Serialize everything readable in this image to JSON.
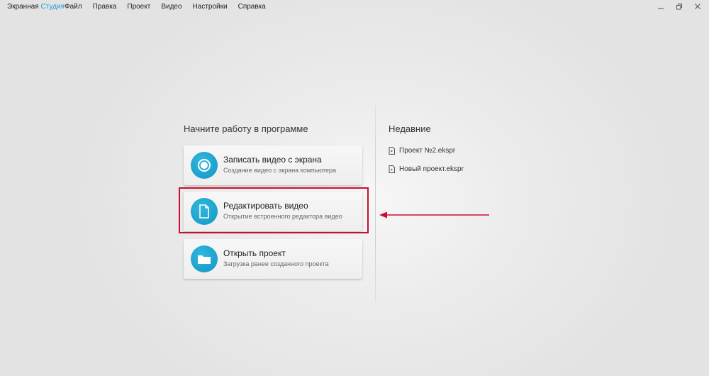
{
  "app": {
    "title_main": "Экранная",
    "title_accent": "Студия",
    "accent_color": "#1a9fd0"
  },
  "menu": [
    "Файл",
    "Правка",
    "Проект",
    "Видео",
    "Настройки",
    "Справка"
  ],
  "window_controls": [
    "minimize-icon",
    "restore-icon",
    "close-icon"
  ],
  "start": {
    "heading": "Начните работу в программе",
    "cards": [
      {
        "title": "Записать видео с экрана",
        "desc": "Создание видео с экрана компьютера",
        "icon": "record-icon"
      },
      {
        "title": "Редактировать видео",
        "desc": "Открытие встроенного редактора видео",
        "icon": "document-icon"
      },
      {
        "title": "Открыть проект",
        "desc": "Загрузка ранее созданного проекта",
        "icon": "folder-icon"
      }
    ]
  },
  "recent": {
    "heading": "Недавние",
    "items": [
      "Проект №2.ekspr",
      "Новый проект.ekspr"
    ]
  },
  "annotation": {
    "highlight_color": "#c8102e",
    "arrow_color": "#c8102e"
  }
}
